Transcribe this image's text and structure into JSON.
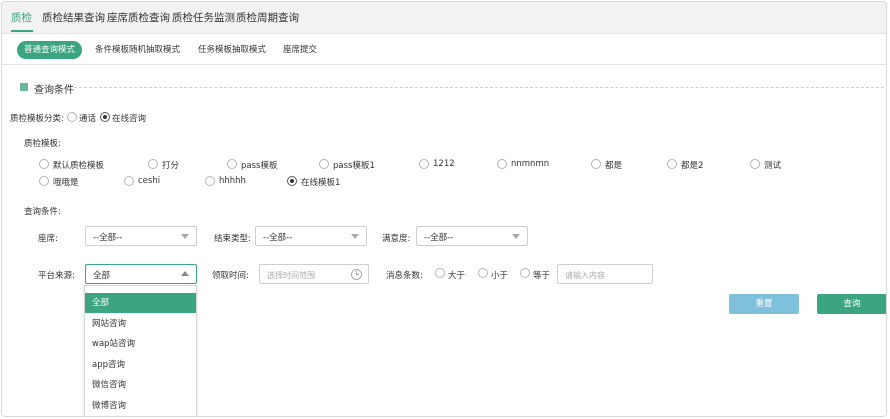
{
  "topnav": {
    "items": [
      "质检",
      "质检结果查询",
      "座席质检查询",
      "质检任务监测",
      "质检周期查询"
    ]
  },
  "subtabs": [
    "普通查询模式",
    "条件模板随机抽取模式",
    "任务模板抽取模式",
    "座席提交"
  ],
  "section": {
    "title": "查询条件"
  },
  "category": {
    "label": "质检模板分类:",
    "options": [
      "通话",
      "在线咨询"
    ],
    "selected": "在线咨询"
  },
  "templates": {
    "label": "质检模板:",
    "options": [
      "默认质检模板",
      "打分",
      "pass模板",
      "pass模板1",
      "1212",
      "nnmnmn",
      "都是",
      "都是2",
      "测试",
      "哦哦是",
      "ceshi",
      "hhhhh",
      "在线模板1"
    ],
    "selected": "在线模板1"
  },
  "conditions": {
    "label": "查询条件:",
    "seat": {
      "label": "座席:",
      "value": "--全部--"
    },
    "end_type": {
      "label": "结束类型:",
      "value": "--全部--"
    },
    "satisfaction": {
      "label": "满意度:",
      "value": "--全部--"
    },
    "platform": {
      "label": "平台来源:",
      "value": "全部",
      "options": [
        "全部",
        "网站咨询",
        "wap站咨询",
        "app咨询",
        "微信咨询",
        "微博咨询"
      ]
    },
    "receive_time": {
      "label": "领取时间:",
      "placeholder": "选择时间范围"
    },
    "msg_count": {
      "label": "消息条数:",
      "options": [
        "大于",
        "小于",
        "等于"
      ],
      "placeholder": "请输入内容"
    }
  },
  "buttons": {
    "reset": "重置",
    "search": "查询"
  },
  "colors": {
    "accent": "#3aa57f",
    "reset": "#7fc0dd"
  },
  "icons": {
    "time": "clock-icon",
    "select": "chevron-down-icon",
    "select_open": "chevron-up-icon",
    "section": "square-bullet-icon"
  }
}
